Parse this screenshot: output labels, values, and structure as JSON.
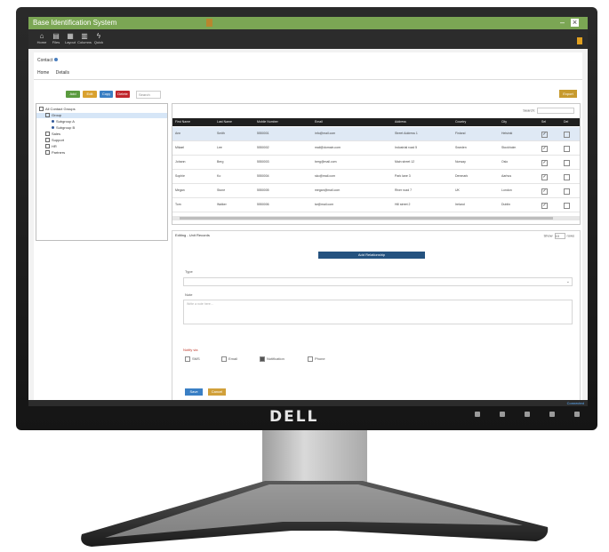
{
  "monitor": {
    "brand": "DELL"
  },
  "app": {
    "title": "Base Identification System"
  },
  "toolbar": {
    "buttons": [
      {
        "icon": "home-icon",
        "label": "Home"
      },
      {
        "icon": "folder-icon",
        "label": "Files"
      },
      {
        "icon": "grid-icon",
        "label": "Layout"
      },
      {
        "icon": "table-icon",
        "label": "Columns"
      },
      {
        "icon": "bolt-icon",
        "label": "Quick"
      }
    ]
  },
  "breadcrumb": {
    "label": "Contact"
  },
  "tabs": [
    "Home",
    "Details"
  ],
  "actions": [
    {
      "label": "Add",
      "color": "#5a9a3e"
    },
    {
      "label": "Edit",
      "color": "#d9a12f"
    },
    {
      "label": "Copy",
      "color": "#3a7fc4"
    },
    {
      "label": "Delete",
      "color": "#c0272d"
    }
  ],
  "actions_search": "Search",
  "actions_right": "Export",
  "tree": {
    "nodes": [
      {
        "label": "All Contact Groups",
        "indent": 0
      },
      {
        "label": "Group",
        "indent": 1
      },
      {
        "label": "Subgroup A",
        "indent": 2
      },
      {
        "label": "Subgroup B",
        "indent": 2
      },
      {
        "label": "Sales",
        "indent": 1
      },
      {
        "label": "Support",
        "indent": 1
      },
      {
        "label": "HR",
        "indent": 1
      },
      {
        "label": "Partners",
        "indent": 1
      }
    ]
  },
  "grid": {
    "search_label": "Search:",
    "columns": [
      "First Name",
      "Last Name",
      "Mobile Number",
      "Email",
      "Address",
      "Country",
      "City",
      "Sel",
      "Del"
    ],
    "rows": [
      [
        "Ann",
        "Smith",
        "5550001",
        "info@mail.com",
        "Street Address 1",
        "Finland",
        "Helsinki"
      ],
      [
        "Mikael",
        "Lee",
        "5550002",
        "mail@domain.com",
        "Industrial road 5",
        "Sweden",
        "Stockholm"
      ],
      [
        "Johann",
        "Berg",
        "5550003",
        "berg@mail.com",
        "Main street 12",
        "Norway",
        "Oslo"
      ],
      [
        "Sophie",
        "Ko",
        "5550004",
        "sko@mail.com",
        "Park lane 3",
        "Denmark",
        "Aarhus"
      ],
      [
        "Megan",
        "Stone",
        "5550005",
        "megan@mail.com",
        "River road 7",
        "UK",
        "London"
      ],
      [
        "Tom",
        "Walker",
        "5550006",
        "tw@mail.com",
        "Hill street 2",
        "Ireland",
        "Dublin"
      ]
    ]
  },
  "editor": {
    "title": "Editing - Unit Records",
    "page_label": "Show",
    "page_size": "10",
    "page_suffix": "rows",
    "bar_label": "Add Relationship",
    "field1_label": "Type",
    "field2_label": "Note",
    "field2_placeholder": "Write a note here...",
    "legend": "Notify via",
    "options": [
      "SMS",
      "Email",
      "Notification",
      "Phone"
    ],
    "option_checked": [
      false,
      false,
      true,
      false
    ],
    "save": "Save",
    "cancel": "Cancel"
  },
  "status": {
    "right": "Connected"
  }
}
